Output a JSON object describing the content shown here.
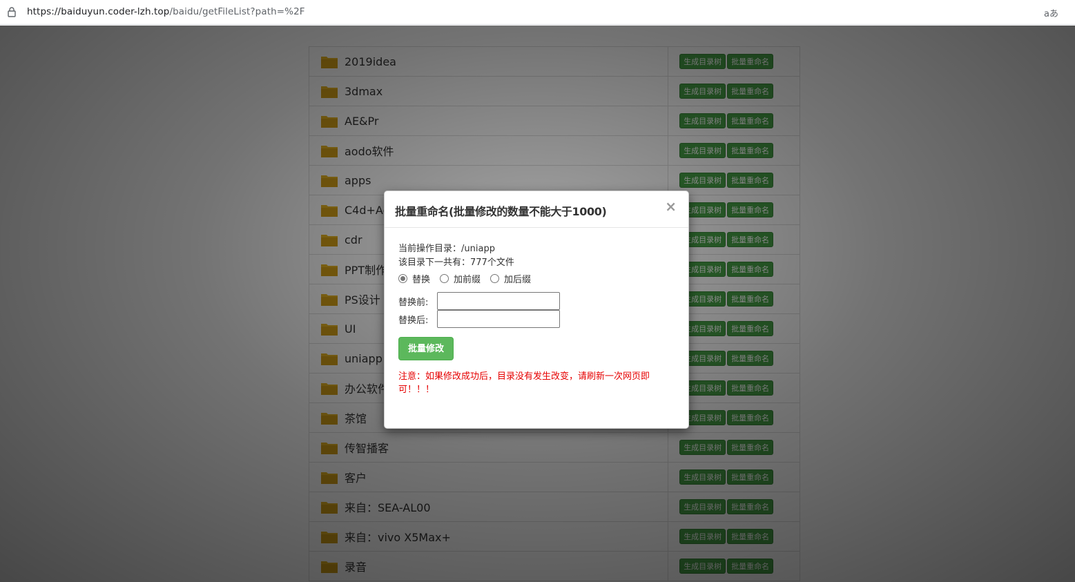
{
  "browser": {
    "url_host": "https://baiduyun.coder-lzh.top",
    "url_path": "/baidu/getFileList?path=%2F",
    "translate_label": "aあ"
  },
  "file_list": {
    "items": [
      {
        "name": "2019idea"
      },
      {
        "name": "3dmax"
      },
      {
        "name": "AE&Pr"
      },
      {
        "name": "aodo软件"
      },
      {
        "name": "apps"
      },
      {
        "name": "C4d+Ae"
      },
      {
        "name": "cdr"
      },
      {
        "name": "PPT制作"
      },
      {
        "name": "PS设计"
      },
      {
        "name": "UI"
      },
      {
        "name": "uniapp"
      },
      {
        "name": "办公软件"
      },
      {
        "name": "茶馆"
      },
      {
        "name": "传智播客"
      },
      {
        "name": "客户"
      },
      {
        "name": "来自：SEA-AL00"
      },
      {
        "name": "来自：vivo X5Max+"
      },
      {
        "name": "录音"
      }
    ],
    "action_tree": "生成目录树",
    "action_rename": "批量重命名"
  },
  "modal": {
    "title": "批量重命名(批量修改的数量不能大于1000)",
    "close": "×",
    "current_dir_label": "当前操作目录：",
    "current_dir": "/uniapp",
    "count_label": "该目录下一共有：",
    "count": "777个文件",
    "options": [
      "替换",
      "加前缀",
      "加后缀"
    ],
    "selected_option": "替换",
    "before_label": "替换前:",
    "after_label": "替换后:",
    "before_value": "",
    "after_value": "",
    "submit": "批量修改",
    "note": "注意：如果修改成功后，目录没有发生改变，请刷新一次网页即可！！！"
  },
  "colors": {
    "action_green": "#449d44",
    "submit_green": "#5cb85c",
    "note_red": "#e60000",
    "folder_yellow": "#e6b422"
  }
}
